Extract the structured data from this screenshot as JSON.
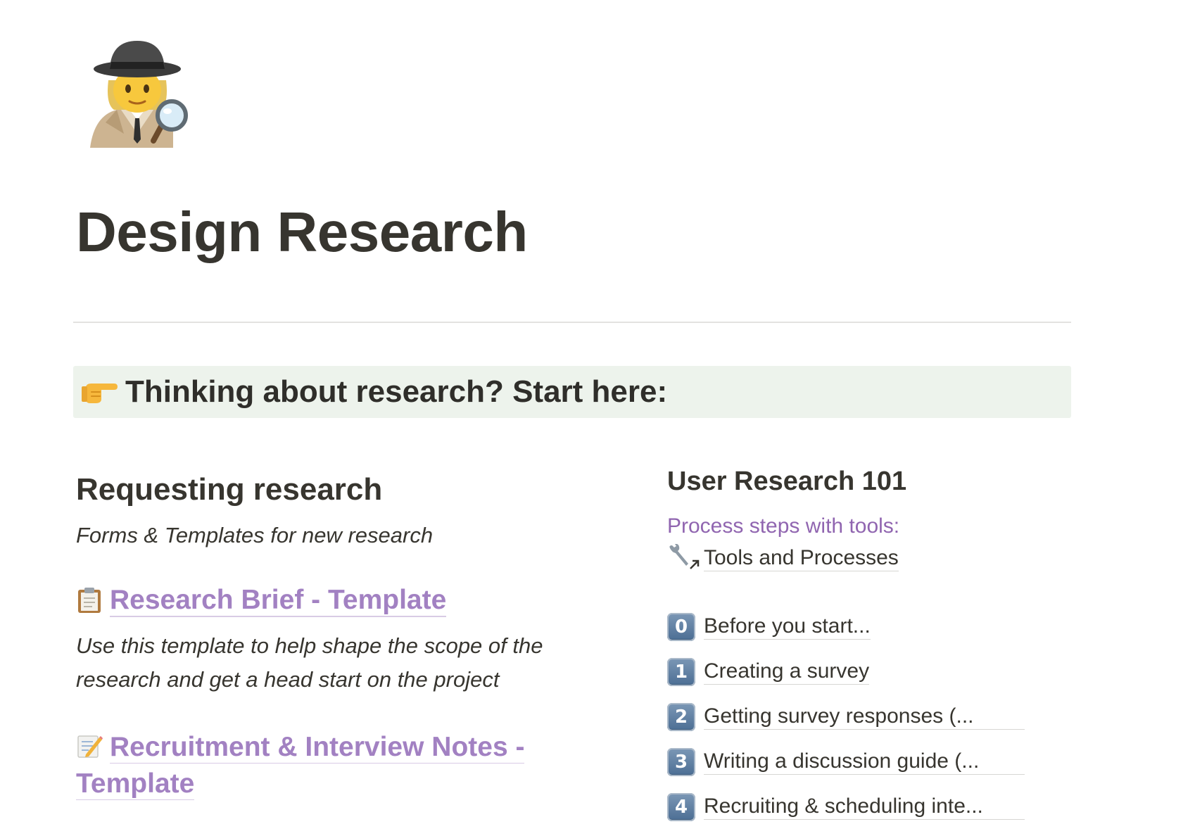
{
  "page": {
    "title": "Design Research",
    "icon": "detective-emoji"
  },
  "callout": {
    "icon": "pointing-right-emoji",
    "text": "Thinking about research? Start here:",
    "background": "#edf3ec"
  },
  "left": {
    "heading": "Requesting research",
    "subtitle": "Forms & Templates for new research",
    "links": [
      {
        "icon": "clipboard-emoji",
        "label": "Research Brief - Template",
        "description": "Use this template to help shape the scope of the research and get a head start on the project"
      },
      {
        "icon": "memo-emoji",
        "label_line1": "Recruitment & Interview Notes -",
        "label_line2": "Template"
      }
    ]
  },
  "right": {
    "heading": "User Research 101",
    "process_label": "Process steps with tools:",
    "tool_link": {
      "icon": "wrench-link-icon",
      "label": "Tools and Processes"
    },
    "steps": [
      {
        "key": "0",
        "label": "Before you start..."
      },
      {
        "key": "1",
        "label": "Creating a survey"
      },
      {
        "key": "2",
        "label": "Getting survey responses (..."
      },
      {
        "key": "3",
        "label": "Writing a discussion guide (..."
      },
      {
        "key": "4",
        "label": "Recruiting & scheduling inte..."
      }
    ]
  },
  "colors": {
    "text": "#37352f",
    "link_purple": "#a281c2",
    "label_purple": "#9065b0",
    "divider": "#e3e2e0"
  }
}
